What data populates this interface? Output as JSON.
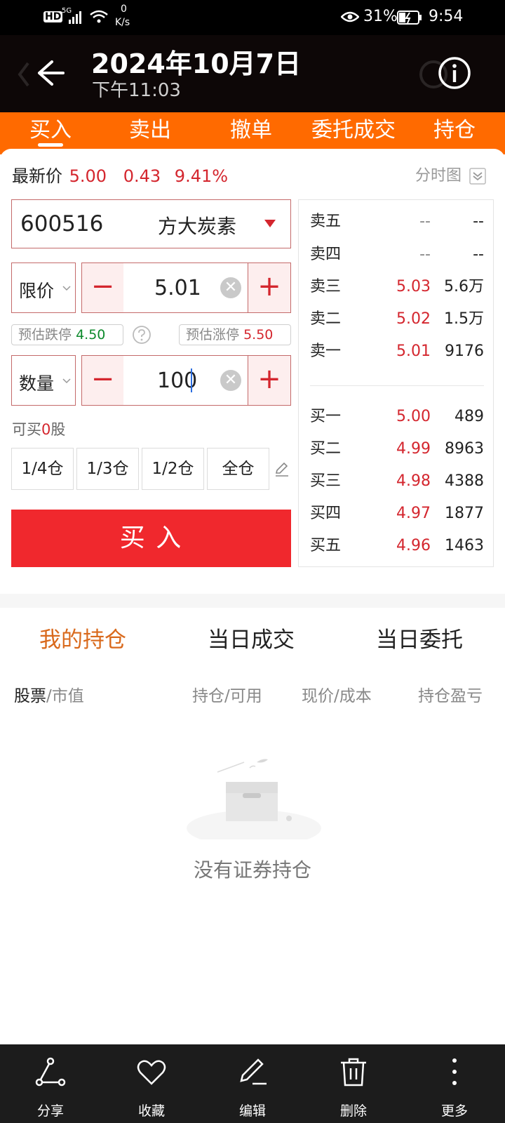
{
  "status_bar": {
    "hd": "HD",
    "network": "5G",
    "speed_value": "0",
    "speed_unit": "K/s",
    "battery": "31%",
    "time": "9:54"
  },
  "header": {
    "date": "2024年10月7日",
    "time": "下午11:03"
  },
  "tabs": [
    {
      "label": "买入",
      "active": true
    },
    {
      "label": "卖出"
    },
    {
      "label": "撤单"
    },
    {
      "label": "委托成交"
    },
    {
      "label": "持仓"
    }
  ],
  "quote": {
    "label": "最新价",
    "price": "5.00",
    "change": "0.43",
    "change_pct": "9.41%",
    "chart_link": "分时图"
  },
  "stock": {
    "code": "600516",
    "name": "方大炭素"
  },
  "price_row": {
    "type": "限价",
    "value": "5.01",
    "minus": "−",
    "plus": "+"
  },
  "limits": {
    "down_label": "预估跌停",
    "down_value": "4.50",
    "up_label": "预估涨停",
    "up_value": "5.50"
  },
  "qty_row": {
    "type": "数量",
    "value": "100"
  },
  "can_buy": {
    "prefix": "可买",
    "count": "0",
    "unit": "股"
  },
  "quick_buttons": [
    "1/4仓",
    "1/3仓",
    "1/2仓",
    "全仓"
  ],
  "buy_button": "买 入",
  "order_book": {
    "sells": [
      {
        "label": "卖五",
        "price": "--",
        "volume": "--"
      },
      {
        "label": "卖四",
        "price": "--",
        "volume": "--"
      },
      {
        "label": "卖三",
        "price": "5.03",
        "volume": "5.6万"
      },
      {
        "label": "卖二",
        "price": "5.02",
        "volume": "1.5万"
      },
      {
        "label": "卖一",
        "price": "5.01",
        "volume": "9176"
      }
    ],
    "buys": [
      {
        "label": "买一",
        "price": "5.00",
        "volume": "489"
      },
      {
        "label": "买二",
        "price": "4.99",
        "volume": "8963"
      },
      {
        "label": "买三",
        "price": "4.98",
        "volume": "4388"
      },
      {
        "label": "买四",
        "price": "4.97",
        "volume": "1877"
      },
      {
        "label": "买五",
        "price": "4.96",
        "volume": "1463"
      }
    ]
  },
  "position_tabs": [
    {
      "label": "我的持仓",
      "active": true
    },
    {
      "label": "当日成交"
    },
    {
      "label": "当日委托"
    }
  ],
  "columns": {
    "stock_a": "股票",
    "stock_b": "/市值",
    "hold": "持仓/可用",
    "price": "现价/成本",
    "pnl": "持仓盈亏"
  },
  "empty_text": "没有证券持仓",
  "bottom_bar": [
    {
      "label": "分享",
      "icon": "share-icon"
    },
    {
      "label": "收藏",
      "icon": "heart-icon"
    },
    {
      "label": "编辑",
      "icon": "pen-icon"
    },
    {
      "label": "删除",
      "icon": "trash-icon"
    },
    {
      "label": "更多",
      "icon": "more-icon"
    }
  ],
  "colors": {
    "accent_orange": "#ff6a00",
    "up_red": "#d4262e",
    "down_green": "#0d8a2c",
    "buy_button": "#f0282d",
    "active_subtab": "#d9691c"
  }
}
